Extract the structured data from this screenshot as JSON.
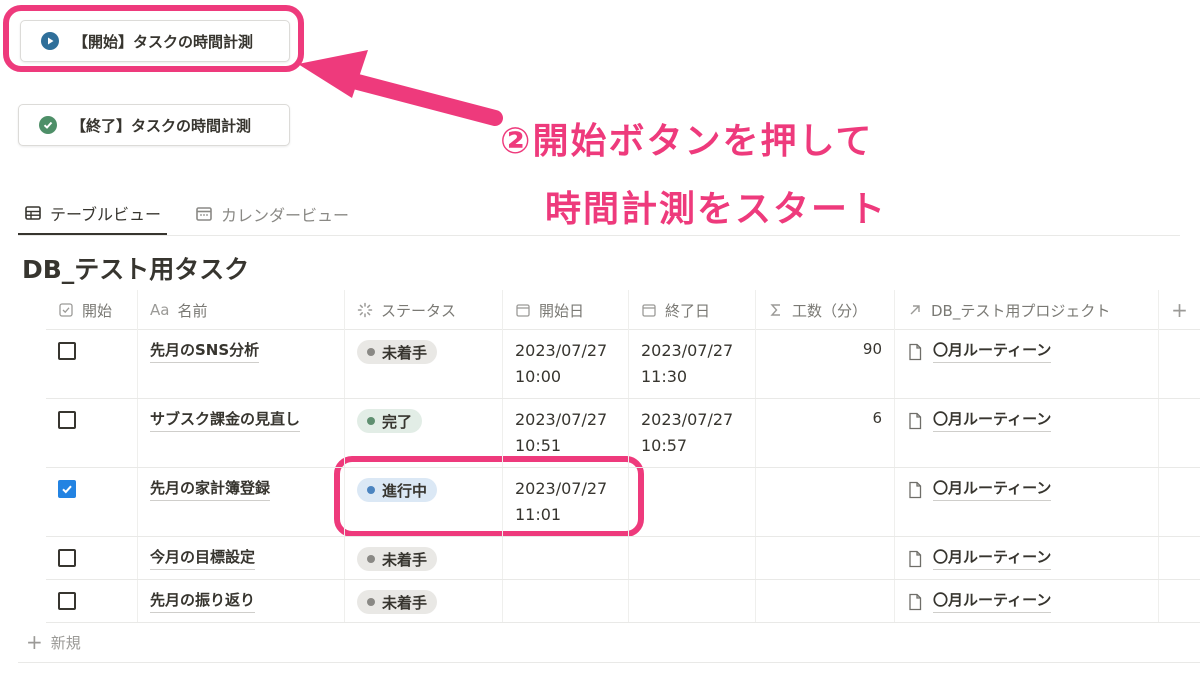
{
  "buttons": {
    "start_label": "【開始】タスクの時間計測",
    "end_label": "【終了】タスクの時間計測"
  },
  "annotation": {
    "line1": "②開始ボタンを押して",
    "line2": "時間計測をスタート",
    "color": "#ee3a7c"
  },
  "tabs": [
    {
      "label": "テーブルビュー",
      "icon": "table-icon"
    },
    {
      "label": "カレンダービュー",
      "icon": "calendar-icon"
    }
  ],
  "database": {
    "title": "DB_テスト用タスク",
    "columns": {
      "start": "開始",
      "name_prefix": "Aa",
      "name": "名前",
      "status": "ステータス",
      "start_date": "開始日",
      "end_date": "終了日",
      "effort": "工数（分）",
      "project": "DB_テスト用プロジェクト",
      "add": "+"
    },
    "rows": [
      {
        "checked": false,
        "name": "先月のSNS分析",
        "status": "未着手",
        "status_type": "todo",
        "start_date": "2023/07/27",
        "start_time": "10:00",
        "end_date": "2023/07/27",
        "end_time": "11:30",
        "effort": "90",
        "project": "〇月ルーティーン"
      },
      {
        "checked": false,
        "name": "サブスク課金の見直し",
        "status": "完了",
        "status_type": "done",
        "start_date": "2023/07/27",
        "start_time": "10:51",
        "end_date": "2023/07/27",
        "end_time": "10:57",
        "effort": "6",
        "project": "〇月ルーティーン"
      },
      {
        "checked": true,
        "name": "先月の家計簿登録",
        "status": "進行中",
        "status_type": "doing",
        "start_date": "2023/07/27",
        "start_time": "11:01",
        "end_date": "",
        "end_time": "",
        "effort": "",
        "project": "〇月ルーティーン"
      },
      {
        "checked": false,
        "name": "今月の目標設定",
        "status": "未着手",
        "status_type": "todo",
        "start_date": "",
        "start_time": "",
        "end_date": "",
        "end_time": "",
        "effort": "",
        "project": "〇月ルーティーン"
      },
      {
        "checked": false,
        "name": "先月の振り返り",
        "status": "未着手",
        "status_type": "todo",
        "start_date": "",
        "start_time": "",
        "end_date": "",
        "end_time": "",
        "effort": "",
        "project": "〇月ルーティーン"
      }
    ],
    "new_label": "新規"
  },
  "colors": {
    "highlight": "#ee3a7c",
    "checkbox_checked": "#2383e2",
    "status_todo": "#e9e8e5",
    "status_done": "#e2ede6",
    "status_doing": "#dbe8f5"
  }
}
